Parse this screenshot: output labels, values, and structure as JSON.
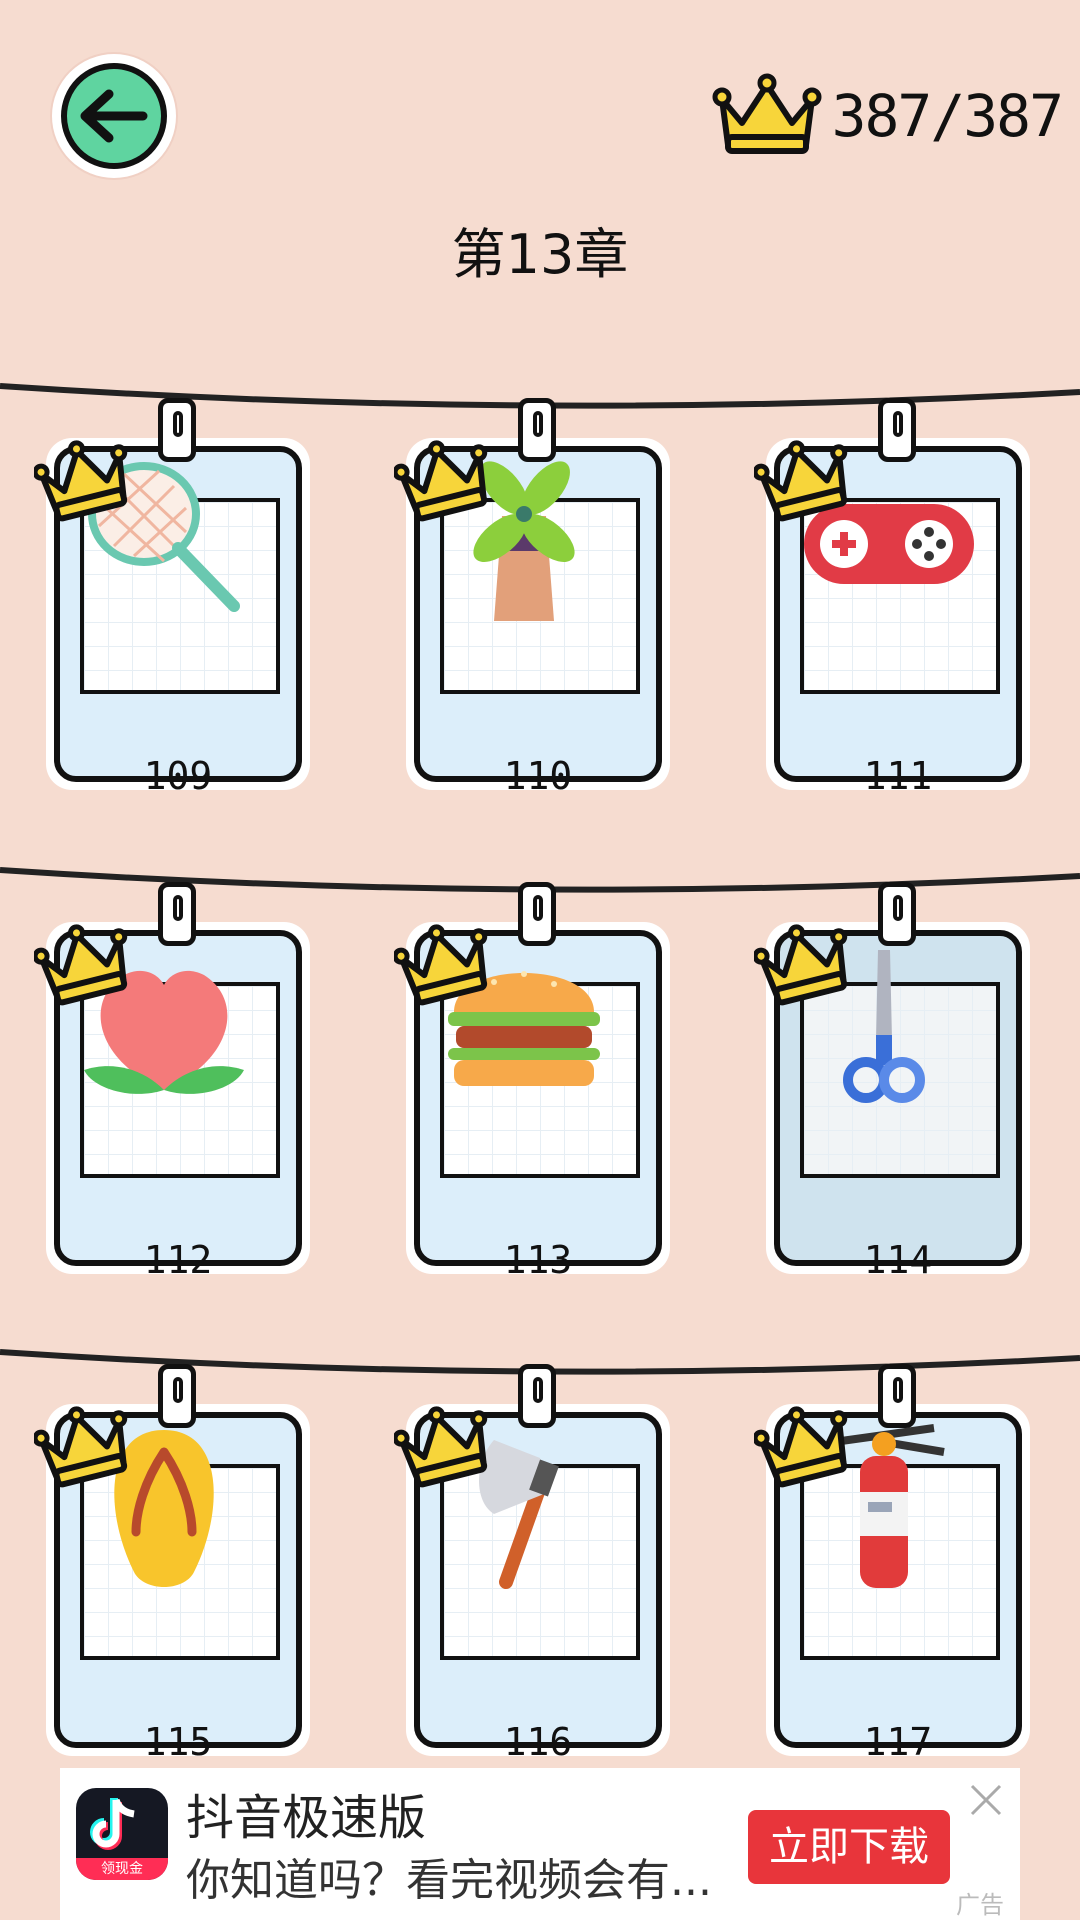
{
  "header": {
    "score": "387/387",
    "chapter_title": "第13章"
  },
  "levels": [
    {
      "number": "109",
      "icon": "tennis-racket",
      "crowned": true
    },
    {
      "number": "110",
      "icon": "windmill",
      "crowned": true
    },
    {
      "number": "111",
      "icon": "game-controller",
      "crowned": true
    },
    {
      "number": "112",
      "icon": "peach",
      "crowned": true
    },
    {
      "number": "113",
      "icon": "hamburger",
      "crowned": true
    },
    {
      "number": "114",
      "icon": "scissors",
      "crowned": true
    },
    {
      "number": "115",
      "icon": "flip-flop",
      "crowned": true
    },
    {
      "number": "116",
      "icon": "axe",
      "crowned": true
    },
    {
      "number": "117",
      "icon": "fire-extinguisher",
      "crowned": true
    }
  ],
  "ad": {
    "app_name": "抖音极速版",
    "description": "你知道吗？看完视频会有...",
    "logo_tag": "领现金",
    "cta": "立即下载",
    "label": "广告"
  },
  "colors": {
    "background": "#f6dcd0",
    "back_button": "#5fd4a0",
    "crown": "#f7d53a",
    "card": "#dceefa",
    "ad_cta": "#e8353b"
  }
}
